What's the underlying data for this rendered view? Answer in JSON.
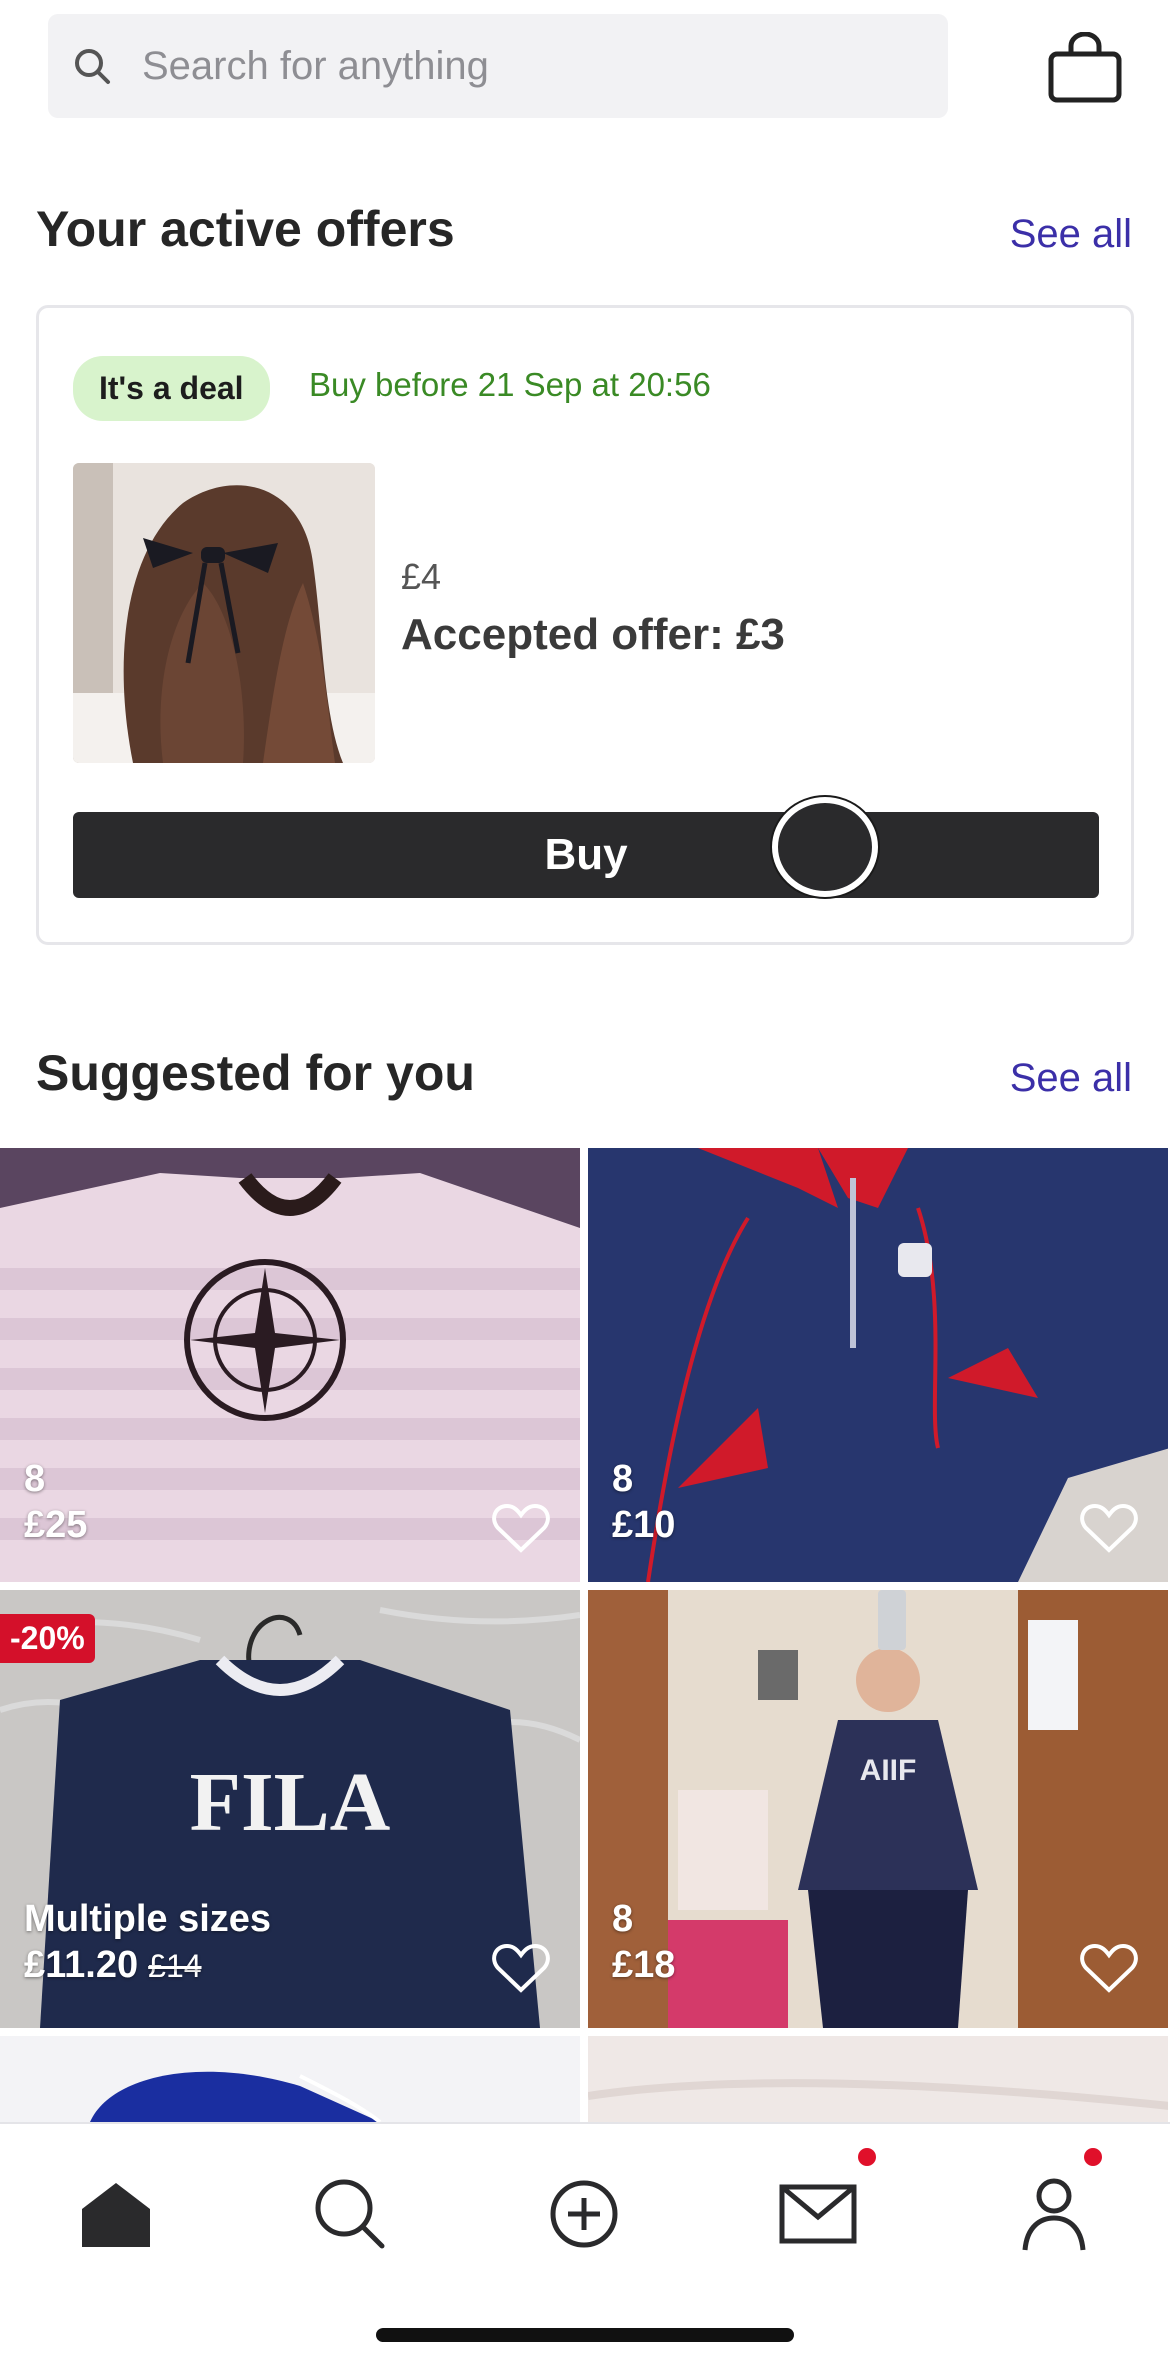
{
  "search": {
    "placeholder": "Search for anything"
  },
  "offers": {
    "title": "Your active offers",
    "see_all": "See all",
    "card": {
      "badge": "It's a deal",
      "deadline": "Buy before 21 Sep at 20:56",
      "price": "£4",
      "accepted": "Accepted offer: £3",
      "buy_label": "Buy"
    }
  },
  "suggested": {
    "title": "Suggested for you",
    "see_all": "See all",
    "items": [
      {
        "size": "8",
        "price": "£25"
      },
      {
        "size": "8",
        "price": "£10"
      },
      {
        "discount": "-20%",
        "size": "Multiple sizes",
        "price": "£11.20",
        "old_price": "£14"
      },
      {
        "size": "8",
        "price": "£18"
      }
    ]
  },
  "nav": {
    "items": [
      "home-icon",
      "search-icon",
      "sell-plus-icon",
      "inbox-mail-icon",
      "profile-icon"
    ]
  },
  "colors": {
    "accent": "#3b2fa8",
    "deal_green": "#3a8a25",
    "badge_bg": "#d8f3cc",
    "buy_bg": "#2a2a2c",
    "notify": "#e0102a"
  }
}
